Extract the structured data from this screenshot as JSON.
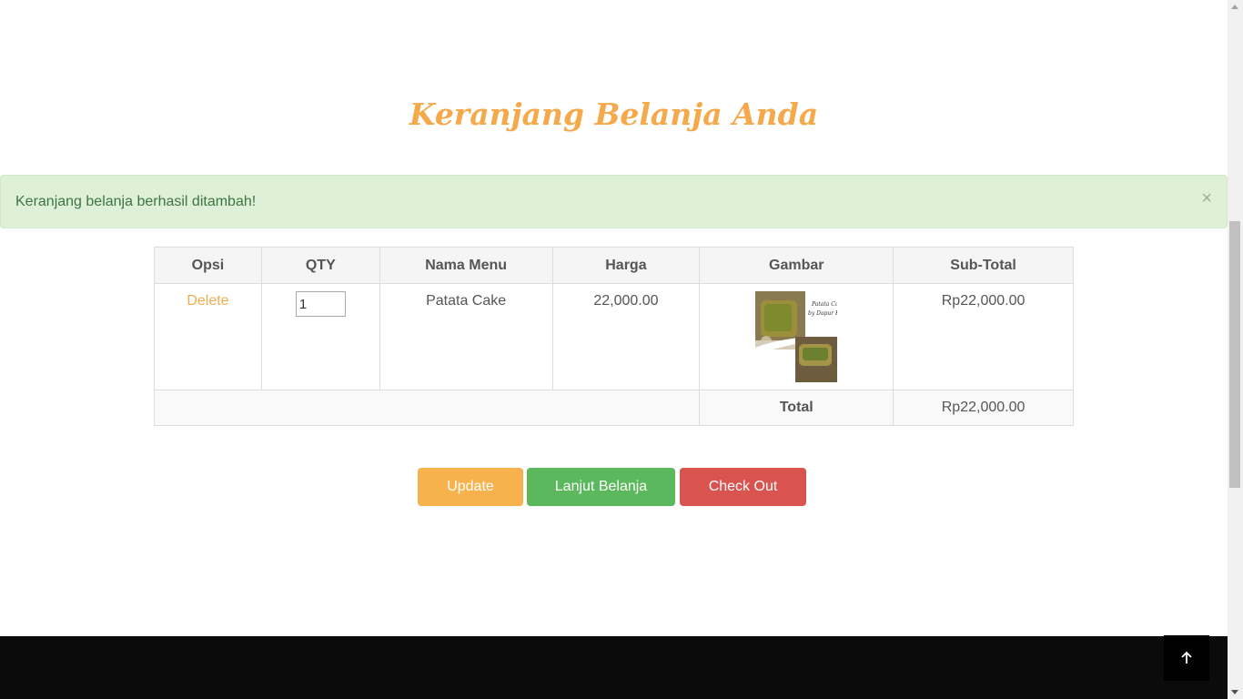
{
  "page": {
    "heading": "Keranjang Belanja Anda"
  },
  "alert": {
    "message": "Keranjang belanja berhasil ditambah!",
    "close_symbol": "×"
  },
  "cart": {
    "headers": [
      "Opsi",
      "QTY",
      "Nama Menu",
      "Harga",
      "Gambar",
      "Sub-Total"
    ],
    "items": [
      {
        "option": "Delete",
        "qty": "1",
        "name": "Patata Cake",
        "price": "22,000.00",
        "image_caption": "Patata Cake by Dapur Kiyo",
        "subtotal": "Rp22,000.00"
      }
    ],
    "total_label": "Total",
    "total_value": "Rp22,000.00"
  },
  "actions": {
    "update": "Update",
    "continue_shopping": "Lanjut Belanja",
    "checkout": "Check Out"
  },
  "colors": {
    "heading": "#f5a94a",
    "alert_bg": "#dff0d8",
    "update": "#f7b24e",
    "continue": "#5cb85c",
    "checkout": "#d9534f",
    "footer": "#0b0b0b"
  },
  "icons": {
    "to_top": "arrow-up-icon",
    "close": "close-icon"
  }
}
